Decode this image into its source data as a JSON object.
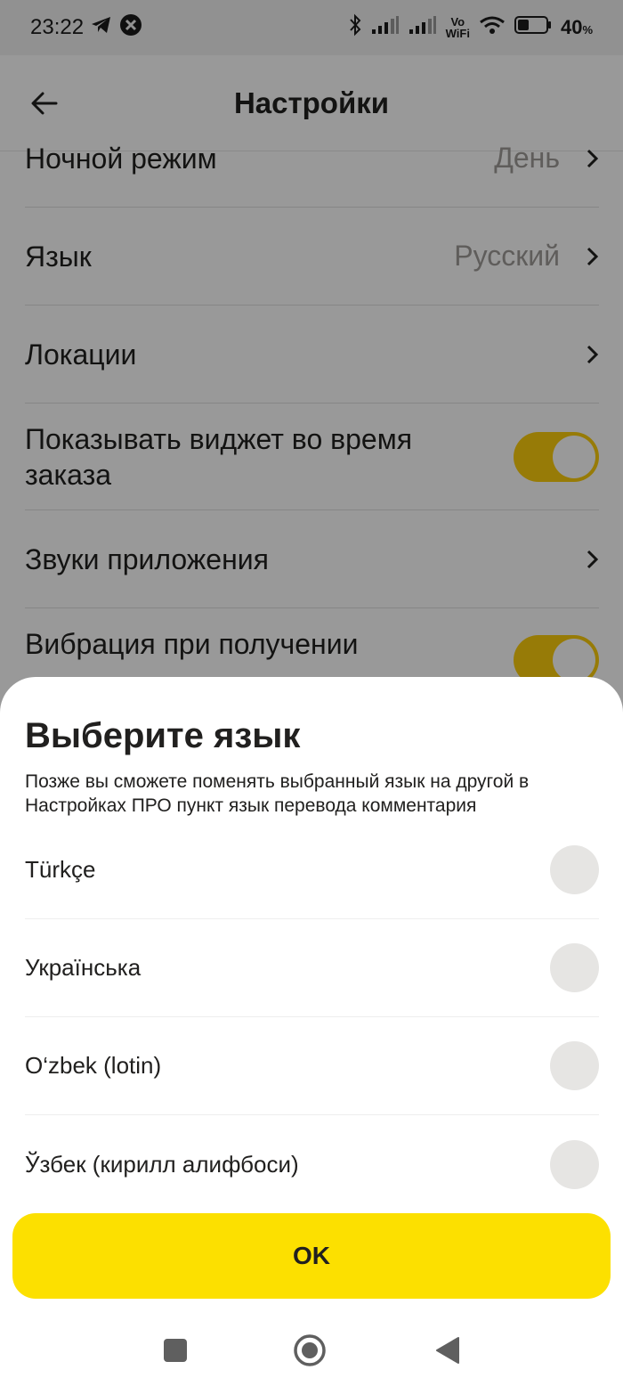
{
  "status_bar": {
    "time": "23:22",
    "battery_percent": "40",
    "battery_unit": "%",
    "vo_label": "Vo",
    "wifi_label": "WiFi"
  },
  "header": {
    "title": "Настройки"
  },
  "settings": {
    "night_mode": {
      "label": "Ночной режим",
      "value": "День"
    },
    "language": {
      "label": "Язык",
      "value": "Русский"
    },
    "locations": {
      "label": "Локации"
    },
    "show_widget": {
      "label": "Показывать виджет во время заказа",
      "enabled": true
    },
    "app_sounds": {
      "label": "Звуки приложения"
    },
    "vibration": {
      "label": "Вибрация при получении",
      "enabled": true
    }
  },
  "language_sheet": {
    "title": "Выберите язык",
    "subtitle": "Позже вы сможете поменять выбранный язык на другой в Настройках ПРО пункт язык перевода комментария",
    "options": [
      {
        "label": "Türkçe",
        "selected": false
      },
      {
        "label": "Українська",
        "selected": false
      },
      {
        "label": "O‘zbek (lotin)",
        "selected": false
      },
      {
        "label": "Ўзбек (кирилл алифбоси)",
        "selected": false
      }
    ],
    "ok_label": "OK"
  },
  "colors": {
    "accent": "#fce000",
    "toggle": "#fcce0c",
    "radio_unselected": "#e6e5e3"
  }
}
